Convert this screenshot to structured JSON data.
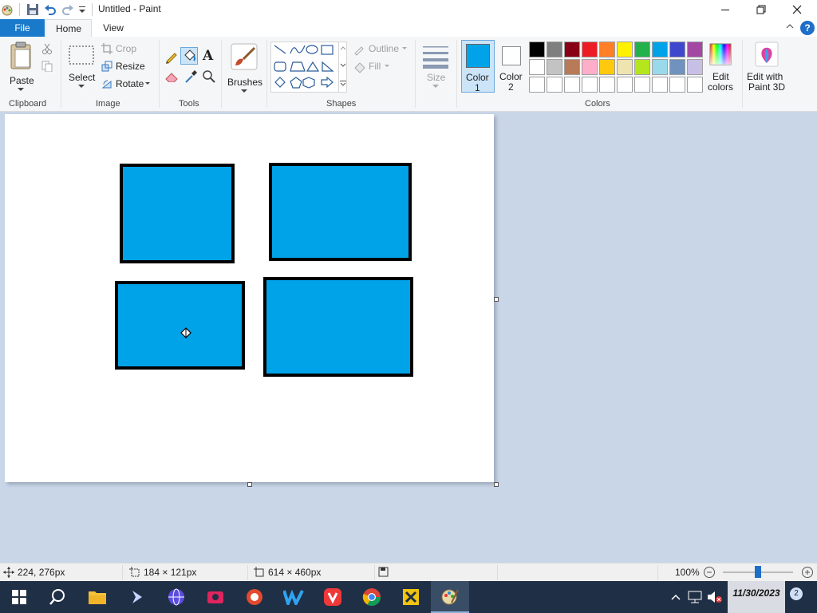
{
  "window": {
    "title": "Untitled - Paint"
  },
  "tabs": [
    {
      "label": "File"
    },
    {
      "label": "Home"
    },
    {
      "label": "View"
    }
  ],
  "help": {
    "label": "?"
  },
  "ribbon": {
    "clipboard": {
      "paste_label": "Paste",
      "group_label": "Clipboard"
    },
    "image": {
      "select_label": "Select",
      "crop_label": "Crop",
      "resize_label": "Resize",
      "rotate_label": "Rotate",
      "group_label": "Image"
    },
    "tools": {
      "text_tool_label": "A",
      "group_label": "Tools"
    },
    "brushes": {
      "label": "Brushes"
    },
    "shapes": {
      "outline_label": "Outline",
      "fill_label": "Fill",
      "group_label": "Shapes"
    },
    "size": {
      "label": "Size"
    },
    "colors": {
      "color1_label": "Color 1",
      "color1_line1": "Color",
      "color1_line2": "1",
      "color2_line1": "Color",
      "color2_line2": "2",
      "color1_value": "#00a2e8",
      "color2_value": "#ffffff",
      "palette_row1": [
        "#000000",
        "#7f7f7f",
        "#880015",
        "#ed1c24",
        "#ff7f27",
        "#fff200",
        "#22b14c",
        "#00a2e8",
        "#3f48cc",
        "#a349a4"
      ],
      "palette_row2": [
        "#ffffff",
        "#c3c3c3",
        "#b97a57",
        "#ffaec9",
        "#ffc90e",
        "#efe4b0",
        "#b5e61d",
        "#99d9ea",
        "#7092be",
        "#c8bfe7"
      ],
      "palette_row3": [
        "#ffffff",
        "#ffffff",
        "#ffffff",
        "#ffffff",
        "#ffffff",
        "#ffffff",
        "#ffffff",
        "#ffffff",
        "#ffffff",
        "#ffffff"
      ],
      "edit_line1": "Edit",
      "edit_line2": "colors",
      "group_label": "Colors"
    },
    "paint3d": {
      "line1": "Edit with",
      "line2": "Paint 3D"
    }
  },
  "status": {
    "cursor_pos": "224, 276px",
    "selection_size": "184 × 121px",
    "image_size": "614 × 460px",
    "zoom": "100%",
    "zoom_level_percent": 100
  },
  "taskbar": {
    "date": "11/30/2023",
    "notifications": "2"
  }
}
